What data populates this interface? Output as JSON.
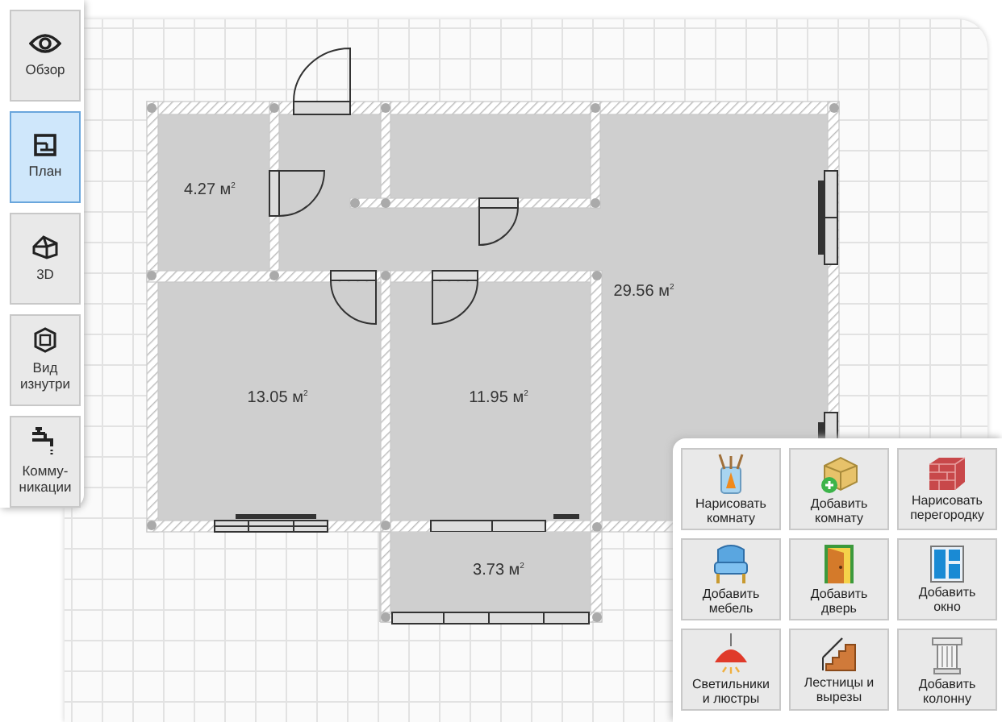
{
  "sidebar": {
    "items": [
      {
        "kind": "eye",
        "label": "Обзор",
        "selected": false
      },
      {
        "kind": "plan",
        "label": "План",
        "selected": true
      },
      {
        "kind": "house",
        "label": "3D",
        "selected": false
      },
      {
        "kind": "cube",
        "label": "Вид изнутри",
        "selected": false
      },
      {
        "kind": "tap",
        "label": "Комму-никации",
        "selected": false
      }
    ]
  },
  "plan": {
    "rooms": [
      {
        "area": "4.27 м$^{2}$"
      },
      {
        "area": "29.56 м$^{2}$"
      },
      {
        "area": "13.05 м$^{2}$"
      },
      {
        "area": "11.95 м$^{2}$"
      },
      {
        "area": "3.73 м$^{2}$"
      }
    ]
  },
  "tools": {
    "items": [
      {
        "kind": "brush",
        "label": "Нарисовать комнату"
      },
      {
        "kind": "room",
        "label": "Добавить комнату"
      },
      {
        "kind": "brick",
        "label": "Нарисовать перегородку"
      },
      {
        "kind": "chair",
        "label": "Добавить мебель"
      },
      {
        "kind": "door",
        "label": "Добавить дверь"
      },
      {
        "kind": "window",
        "label": "Добавить окно"
      },
      {
        "kind": "lamp",
        "label": "Светильники и люстры"
      },
      {
        "kind": "stairs",
        "label": "Лестницы и вырезы"
      },
      {
        "kind": "column",
        "label": "Добавить колонну"
      }
    ]
  }
}
